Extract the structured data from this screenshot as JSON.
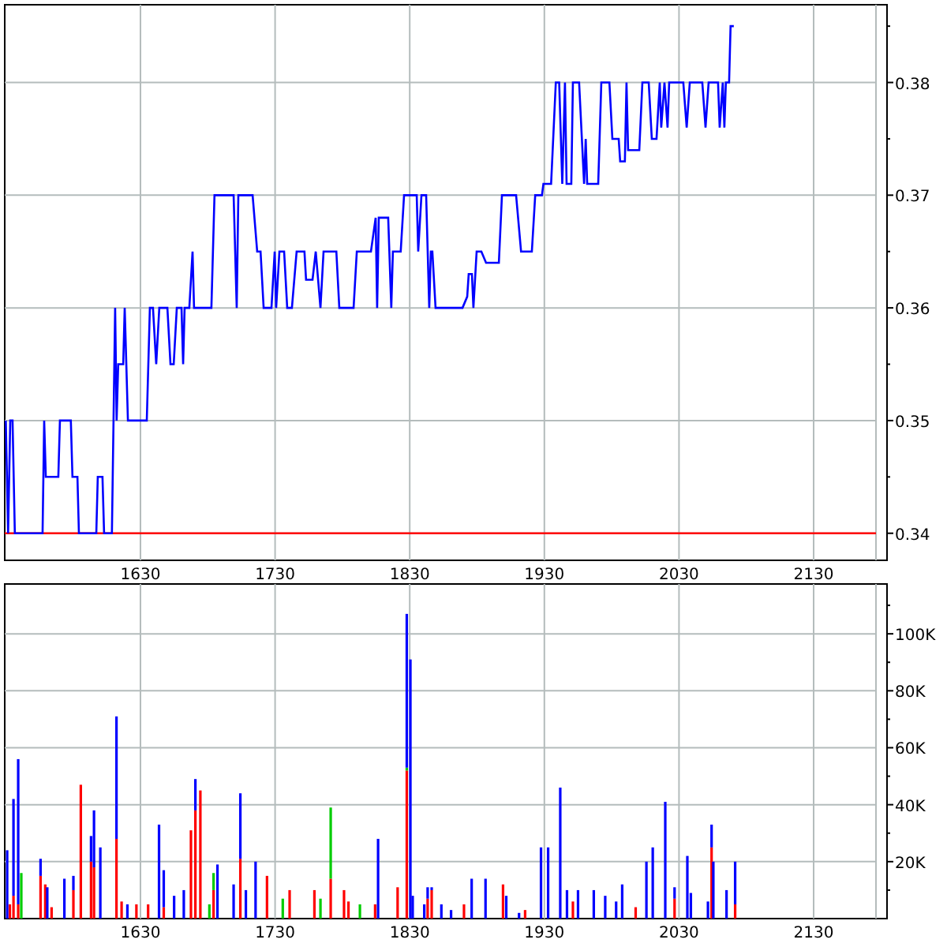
{
  "price_chart": {
    "chart_data": {
      "type": "line",
      "xlim": [
        1529.2,
        2184.5
      ],
      "ylim": [
        0.3376,
        0.3869
      ],
      "xticks": [
        1630,
        1730,
        1830,
        1930,
        2030,
        2130
      ],
      "yticks": [
        {
          "value": 0.34,
          "label": "0.34"
        },
        {
          "value": 0.35,
          "label": "0.35"
        },
        {
          "value": 0.36,
          "label": "0.36"
        },
        {
          "value": 0.37,
          "label": "0.37"
        },
        {
          "value": 0.38,
          "label": "0.38"
        }
      ],
      "grid": true,
      "ref_lines": [
        {
          "axis": "y",
          "value": 0.34,
          "color": "#ff0000"
        }
      ],
      "x": [
        1530,
        1531.7,
        1533.3,
        1535,
        1536.7,
        1539.7,
        1557.3,
        1558.5,
        1559.7,
        1569,
        1570.2,
        1578.3,
        1579.5,
        1583.2,
        1584.3,
        1597.2,
        1598.3,
        1601.8,
        1603,
        1608.8,
        1610,
        1611.2,
        1612.3,
        1613.5,
        1617.2,
        1618.3,
        1620.7,
        1634.7,
        1637,
        1639.3,
        1641.7,
        1644,
        1650,
        1652.3,
        1654.7,
        1657,
        1660.5,
        1661.7,
        1662.8,
        1666.3,
        1668.7,
        1669.8,
        1682.7,
        1685,
        1699.2,
        1701.5,
        1702.7,
        1709.7,
        1713.3,
        1716.7,
        1719.2,
        1721.5,
        1727.3,
        1729.7,
        1730.8,
        1733.2,
        1736.7,
        1739,
        1742.5,
        1746,
        1751.8,
        1753,
        1757.8,
        1760.2,
        1763.7,
        1766,
        1775.5,
        1777.7,
        1788.3,
        1790.7,
        1801.2,
        1804.7,
        1805.8,
        1807,
        1814,
        1816.3,
        1817.5,
        1823.3,
        1825.8,
        1835.2,
        1836.3,
        1838.7,
        1842.2,
        1844.5,
        1845.7,
        1846.8,
        1849.2,
        1869.2,
        1872.7,
        1873.8,
        1876.2,
        1877.3,
        1879.7,
        1883.2,
        1886.7,
        1896.2,
        1898.5,
        1909,
        1912.7,
        1920.7,
        1923.2,
        1928.2,
        1929.3,
        1935,
        1938.5,
        1941,
        1943.3,
        1945.3,
        1946.5,
        1950,
        1951.2,
        1955.8,
        1959.5,
        1960.7,
        1961.8,
        1970,
        1972.3,
        1978.3,
        1980.5,
        1985.2,
        1986.3,
        1989.8,
        1991,
        1992.2,
        2000.5,
        2002.8,
        2007.5,
        2009.8,
        2013.3,
        2015.7,
        2016.8,
        2019.2,
        2021.5,
        2022.7,
        2033.2,
        2035.7,
        2038,
        2047.3,
        2049.7,
        2052,
        2059,
        2060.2,
        2062.5,
        2063.7,
        2064.8,
        2067.2,
        2068.3,
        2070.7
      ],
      "series": [
        {
          "color": "#0000ff",
          "values": [
            0.35,
            0.34,
            0.35,
            0.35,
            0.34,
            0.34,
            0.34,
            0.35,
            0.345,
            0.345,
            0.35,
            0.35,
            0.345,
            0.345,
            0.34,
            0.34,
            0.345,
            0.345,
            0.34,
            0.34,
            0.35,
            0.36,
            0.35,
            0.355,
            0.355,
            0.36,
            0.35,
            0.35,
            0.36,
            0.36,
            0.355,
            0.36,
            0.36,
            0.355,
            0.355,
            0.36,
            0.36,
            0.355,
            0.36,
            0.36,
            0.365,
            0.36,
            0.36,
            0.37,
            0.37,
            0.36,
            0.37,
            0.37,
            0.37,
            0.365,
            0.365,
            0.36,
            0.36,
            0.365,
            0.36,
            0.365,
            0.365,
            0.36,
            0.36,
            0.365,
            0.365,
            0.3625,
            0.3625,
            0.365,
            0.36,
            0.365,
            0.365,
            0.36,
            0.36,
            0.365,
            0.365,
            0.368,
            0.36,
            0.368,
            0.368,
            0.36,
            0.365,
            0.365,
            0.37,
            0.37,
            0.365,
            0.37,
            0.37,
            0.36,
            0.365,
            0.365,
            0.36,
            0.36,
            0.361,
            0.363,
            0.363,
            0.36,
            0.365,
            0.365,
            0.364,
            0.364,
            0.37,
            0.37,
            0.365,
            0.365,
            0.37,
            0.37,
            0.371,
            0.371,
            0.38,
            0.38,
            0.371,
            0.38,
            0.371,
            0.371,
            0.38,
            0.38,
            0.371,
            0.375,
            0.371,
            0.371,
            0.38,
            0.38,
            0.375,
            0.375,
            0.373,
            0.373,
            0.38,
            0.374,
            0.374,
            0.38,
            0.38,
            0.375,
            0.375,
            0.38,
            0.376,
            0.38,
            0.376,
            0.38,
            0.38,
            0.376,
            0.38,
            0.38,
            0.376,
            0.38,
            0.38,
            0.376,
            0.38,
            0.376,
            0.38,
            0.38,
            0.385,
            0.385
          ]
        }
      ]
    }
  },
  "volume_chart": {
    "chart_data": {
      "type": "bar",
      "stacked": true,
      "grid": true,
      "xlim": [
        1529.2,
        2184.5
      ],
      "ylim": [
        0,
        117.5
      ],
      "xticks": [
        1630,
        1730,
        1830,
        1930,
        2030,
        2130
      ],
      "yticks": [
        {
          "value": 20,
          "label": "20K"
        },
        {
          "value": 40,
          "label": "40K"
        },
        {
          "value": 60,
          "label": "60K"
        },
        {
          "value": 80,
          "label": "80K"
        },
        {
          "value": 100,
          "label": "100K"
        }
      ],
      "x": [
        1531,
        1533,
        1535.7,
        1539.2,
        1541.5,
        1555.8,
        1559.3,
        1560.8,
        1564,
        1573.5,
        1580.2,
        1585.7,
        1593.3,
        1595.5,
        1600.2,
        1612.2,
        1616,
        1620.3,
        1627,
        1635.7,
        1643.8,
        1647.3,
        1655,
        1662.2,
        1667.5,
        1670.8,
        1674.5,
        1681.2,
        1684.3,
        1687.2,
        1699.2,
        1704.2,
        1708.3,
        1715.5,
        1724,
        1735.7,
        1740.8,
        1759.2,
        1763.7,
        1771.3,
        1781.2,
        1784.5,
        1793,
        1804.3,
        1806.5,
        1821,
        1827.8,
        1830.5,
        1832.2,
        1840.8,
        1843.3,
        1846.3,
        1853.5,
        1860.7,
        1870.3,
        1876,
        1886.3,
        1899.3,
        1901.7,
        1911.2,
        1915.7,
        1927.5,
        1932.8,
        1941.8,
        1946.8,
        1951.2,
        1955,
        1966.7,
        1975.2,
        1983.3,
        1987.8,
        1997.8,
        2005.8,
        2010.5,
        2019.8,
        2026.7,
        2036.2,
        2038.8,
        2051.5,
        2054.2,
        2055.5,
        2065.3,
        2071.7
      ],
      "series": [
        {
          "color": "#ff0000",
          "values": [
            0,
            5,
            8,
            5,
            0,
            15,
            12,
            0,
            4,
            0,
            10,
            47,
            20,
            18,
            0,
            28,
            6,
            0,
            5,
            5,
            0,
            4,
            0,
            0,
            31,
            38,
            45,
            0,
            10,
            0,
            0,
            21,
            0,
            0,
            15,
            0,
            10,
            10,
            0,
            14,
            10,
            6,
            0,
            5,
            0,
            11,
            52,
            0,
            0,
            0,
            7,
            10,
            0,
            0,
            5,
            0,
            0,
            12,
            0,
            0,
            3,
            0,
            0,
            0,
            0,
            6,
            0,
            0,
            0,
            0,
            0,
            4,
            0,
            0,
            0,
            7,
            0,
            0,
            0,
            25,
            0,
            0,
            5
          ]
        },
        {
          "color": "#00cc00",
          "values": [
            0,
            0,
            0,
            0,
            16,
            0,
            0,
            0,
            0,
            0,
            0,
            0,
            0,
            0,
            0,
            0,
            0,
            0,
            0,
            0,
            0,
            0,
            0,
            0,
            0,
            0,
            0,
            5,
            6,
            0,
            0,
            0,
            0,
            0,
            0,
            7,
            0,
            0,
            7,
            25,
            0,
            0,
            5,
            0,
            0,
            0,
            1,
            0,
            0,
            0,
            0,
            0,
            0,
            0,
            0,
            0,
            0,
            0,
            0,
            0,
            0,
            0,
            0,
            0,
            0,
            0,
            0,
            0,
            0,
            0,
            0,
            0,
            0,
            0,
            0,
            0,
            0,
            0,
            0,
            0,
            0,
            0,
            0
          ]
        },
        {
          "color": "#0000ff",
          "values": [
            24,
            0,
            34,
            51,
            0,
            6,
            0,
            11,
            0,
            14,
            5,
            0,
            9,
            20,
            25,
            43,
            0,
            5,
            0,
            0,
            33,
            13,
            8,
            10,
            0,
            11,
            0,
            0,
            0,
            19,
            12,
            23,
            10,
            20,
            0,
            0,
            0,
            0,
            0,
            0,
            0,
            0,
            0,
            0,
            28,
            0,
            54,
            91,
            8,
            5,
            4,
            1,
            5,
            3,
            0,
            14,
            14,
            0,
            8,
            2,
            0,
            25,
            25,
            46,
            10,
            0,
            10,
            10,
            8,
            6,
            12,
            0,
            20,
            25,
            41,
            4,
            22,
            9,
            6,
            8,
            20,
            10,
            15
          ]
        }
      ]
    }
  }
}
